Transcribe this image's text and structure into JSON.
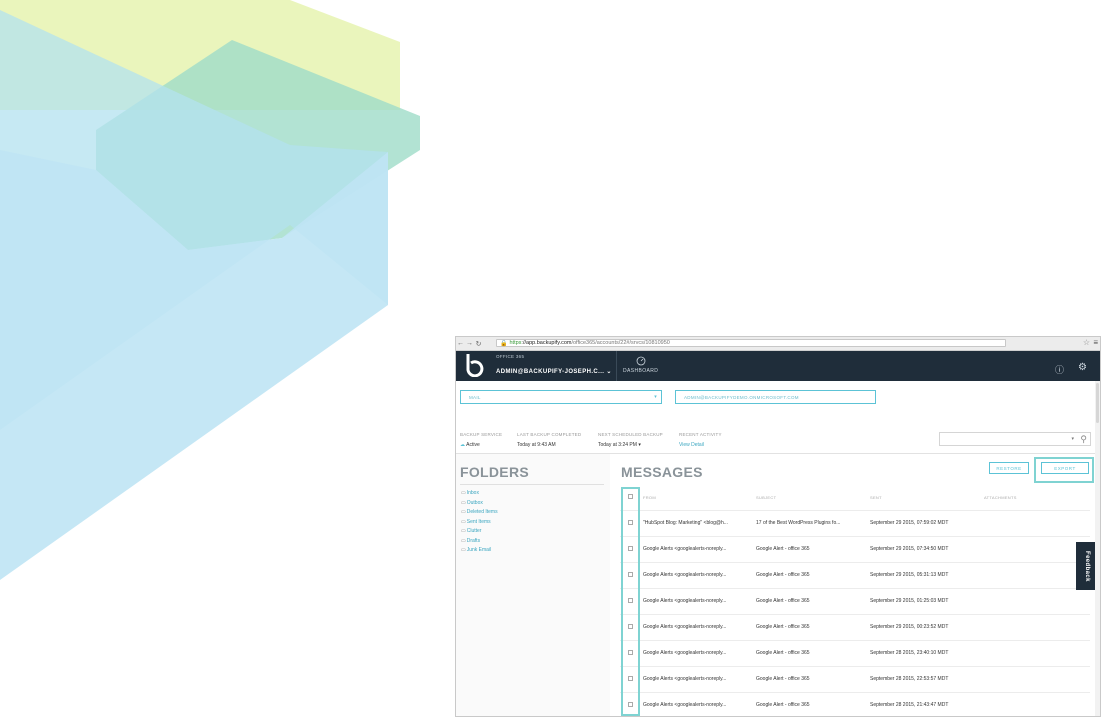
{
  "colors": {
    "header_bg": "#1f2d3a",
    "accent": "#5cc3d6",
    "highlight": "#7fd3d2",
    "link": "#3aa6c0",
    "shape_yellow": "#e8f3b6",
    "shape_green": "#a6dfcf",
    "shape_blue": "#b6e1f2"
  },
  "browser": {
    "url_https": "https",
    "url_host": "://app.backupify.com",
    "url_path": "/office365/accounts/22#/srvcs/10810950"
  },
  "header": {
    "app_name": "OFFICE 365",
    "account": "ADMIN@BACKUPIFY-JOSEPH.C...",
    "dashboard_label": "DASHBOARD"
  },
  "filters": {
    "service": "MAIL",
    "account_email": "ADMIN@BACKUPIFYDEMO.ONMICROSOFT.COM"
  },
  "stats": {
    "backup_service_label": "BACKUP SERVICE",
    "backup_service_value": "Active",
    "last_backup_label": "LAST BACKUP COMPLETED",
    "last_backup_value": "Today at 9:43 AM",
    "next_backup_label": "NEXT SCHEDULED BACKUP",
    "next_backup_value": "Today at 3:24 PM",
    "recent_activity_label": "RECENT ACTIVITY",
    "recent_activity_value": "View Detail"
  },
  "folders": {
    "title": "FOLDERS",
    "items": [
      "Inbox",
      "Outbox",
      "Deleted Items",
      "Sent Items",
      "Clutter",
      "Drafts",
      "Junk Email"
    ]
  },
  "messages": {
    "title": "MESSAGES",
    "restore_label": "RESTORE",
    "export_label": "EXPORT",
    "columns": [
      "FROM",
      "SUBJECT",
      "SENT",
      "ATTACHMENTS"
    ],
    "rows": [
      {
        "from": "\"HubSpot Blog: Marketing\" <blog@h...",
        "subject": "17 of the Best WordPress Plugins fo...",
        "sent": "September 29 2015, 07:59:02 MDT"
      },
      {
        "from": "Google Alerts <googlealerts-noreply...",
        "subject": "Google Alert - office 365",
        "sent": "September 29 2015, 07:34:50 MDT"
      },
      {
        "from": "Google Alerts <googlealerts-noreply...",
        "subject": "Google Alert - office 365",
        "sent": "September 29 2015, 05:31:13 MDT"
      },
      {
        "from": "Google Alerts <googlealerts-noreply...",
        "subject": "Google Alert - office 365",
        "sent": "September 29 2015, 01:25:03 MDT"
      },
      {
        "from": "Google Alerts <googlealerts-noreply...",
        "subject": "Google Alert - office 365",
        "sent": "September 29 2015, 00:23:52 MDT"
      },
      {
        "from": "Google Alerts <googlealerts-noreply...",
        "subject": "Google Alert - office 365",
        "sent": "September 28 2015, 23:40:10 MDT"
      },
      {
        "from": "Google Alerts <googlealerts-noreply...",
        "subject": "Google Alert - office 365",
        "sent": "September 28 2015, 22:53:57 MDT"
      },
      {
        "from": "Google Alerts <googlealerts-noreply...",
        "subject": "Google Alert - office 365",
        "sent": "September 28 2015, 21:43:47 MDT"
      }
    ]
  },
  "feedback_label": "Feedback"
}
